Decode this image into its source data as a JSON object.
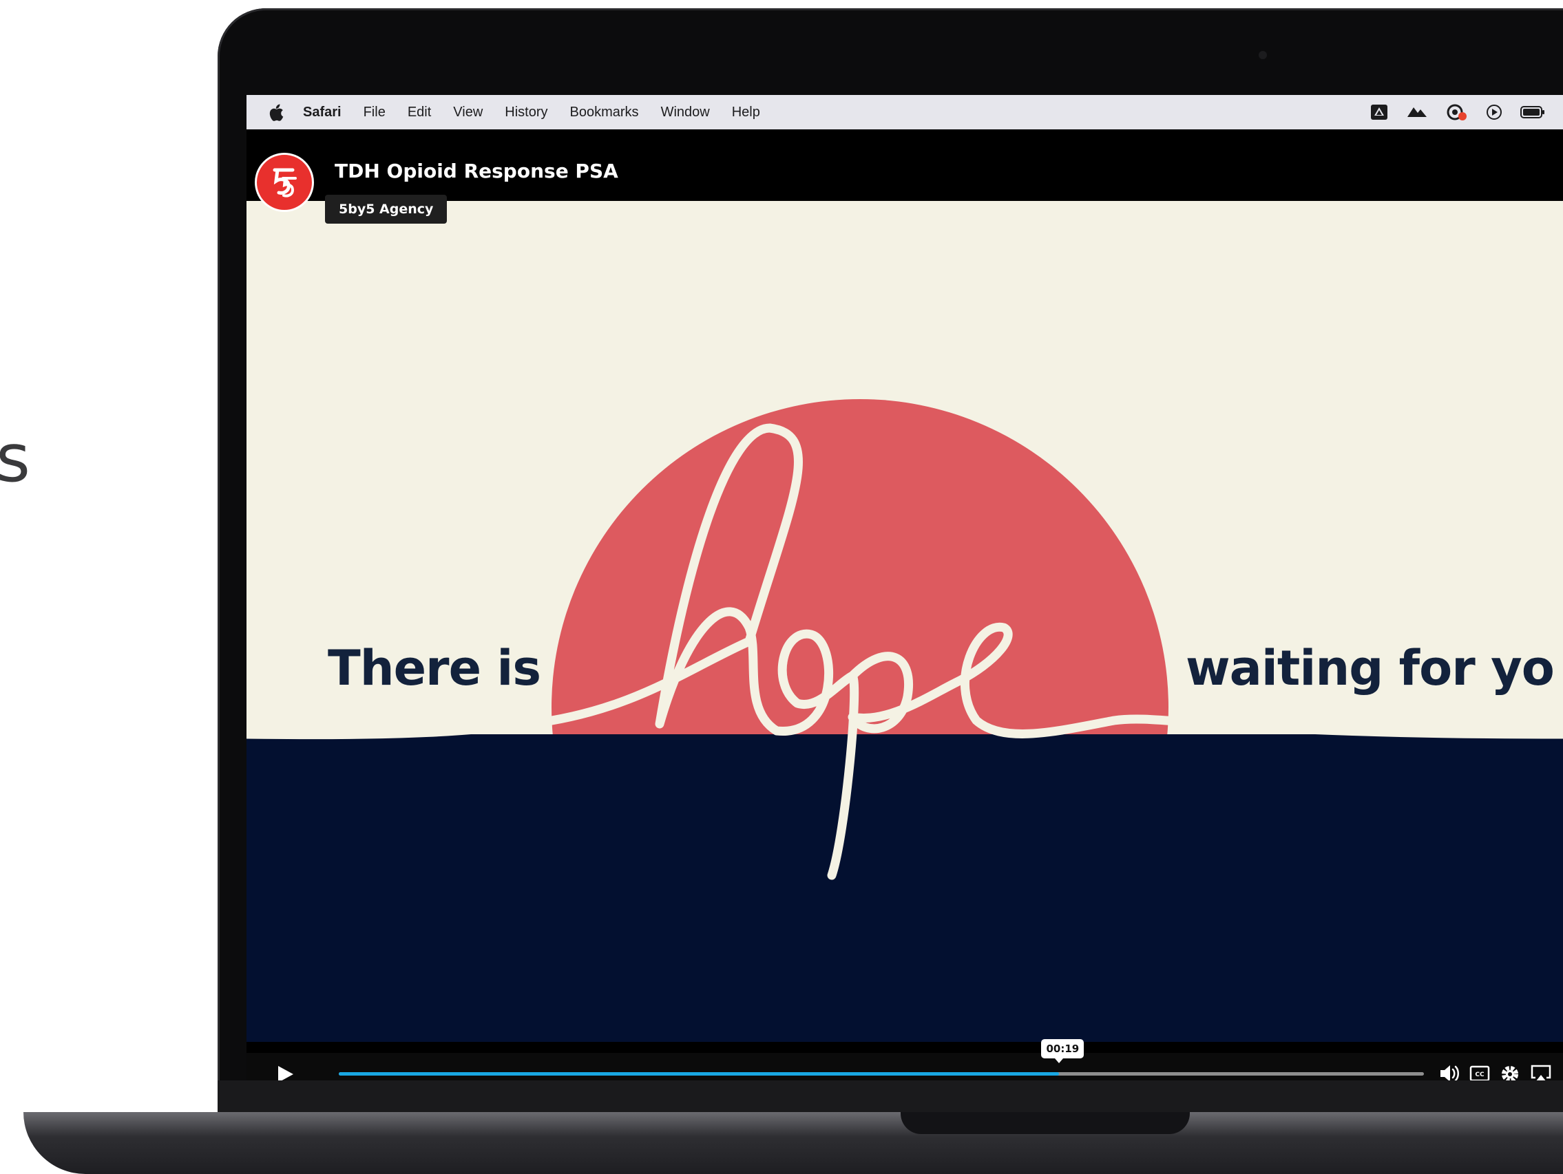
{
  "side_text": "s",
  "menubar": {
    "app": "Safari",
    "items": [
      "File",
      "Edit",
      "View",
      "History",
      "Bookmarks",
      "Window",
      "Help"
    ]
  },
  "video": {
    "title": "TDH Opioid Response PSA",
    "channel": "5by5 Agency",
    "phrase_left": "There is",
    "phrase_script": "hope",
    "phrase_right": "waiting for yo",
    "time": "00:19",
    "progress": 0.664
  },
  "colors": {
    "cream": "#f4f2e4",
    "coral": "#dd5a5f",
    "navy": "#031030",
    "progress": "#19a7e3"
  }
}
